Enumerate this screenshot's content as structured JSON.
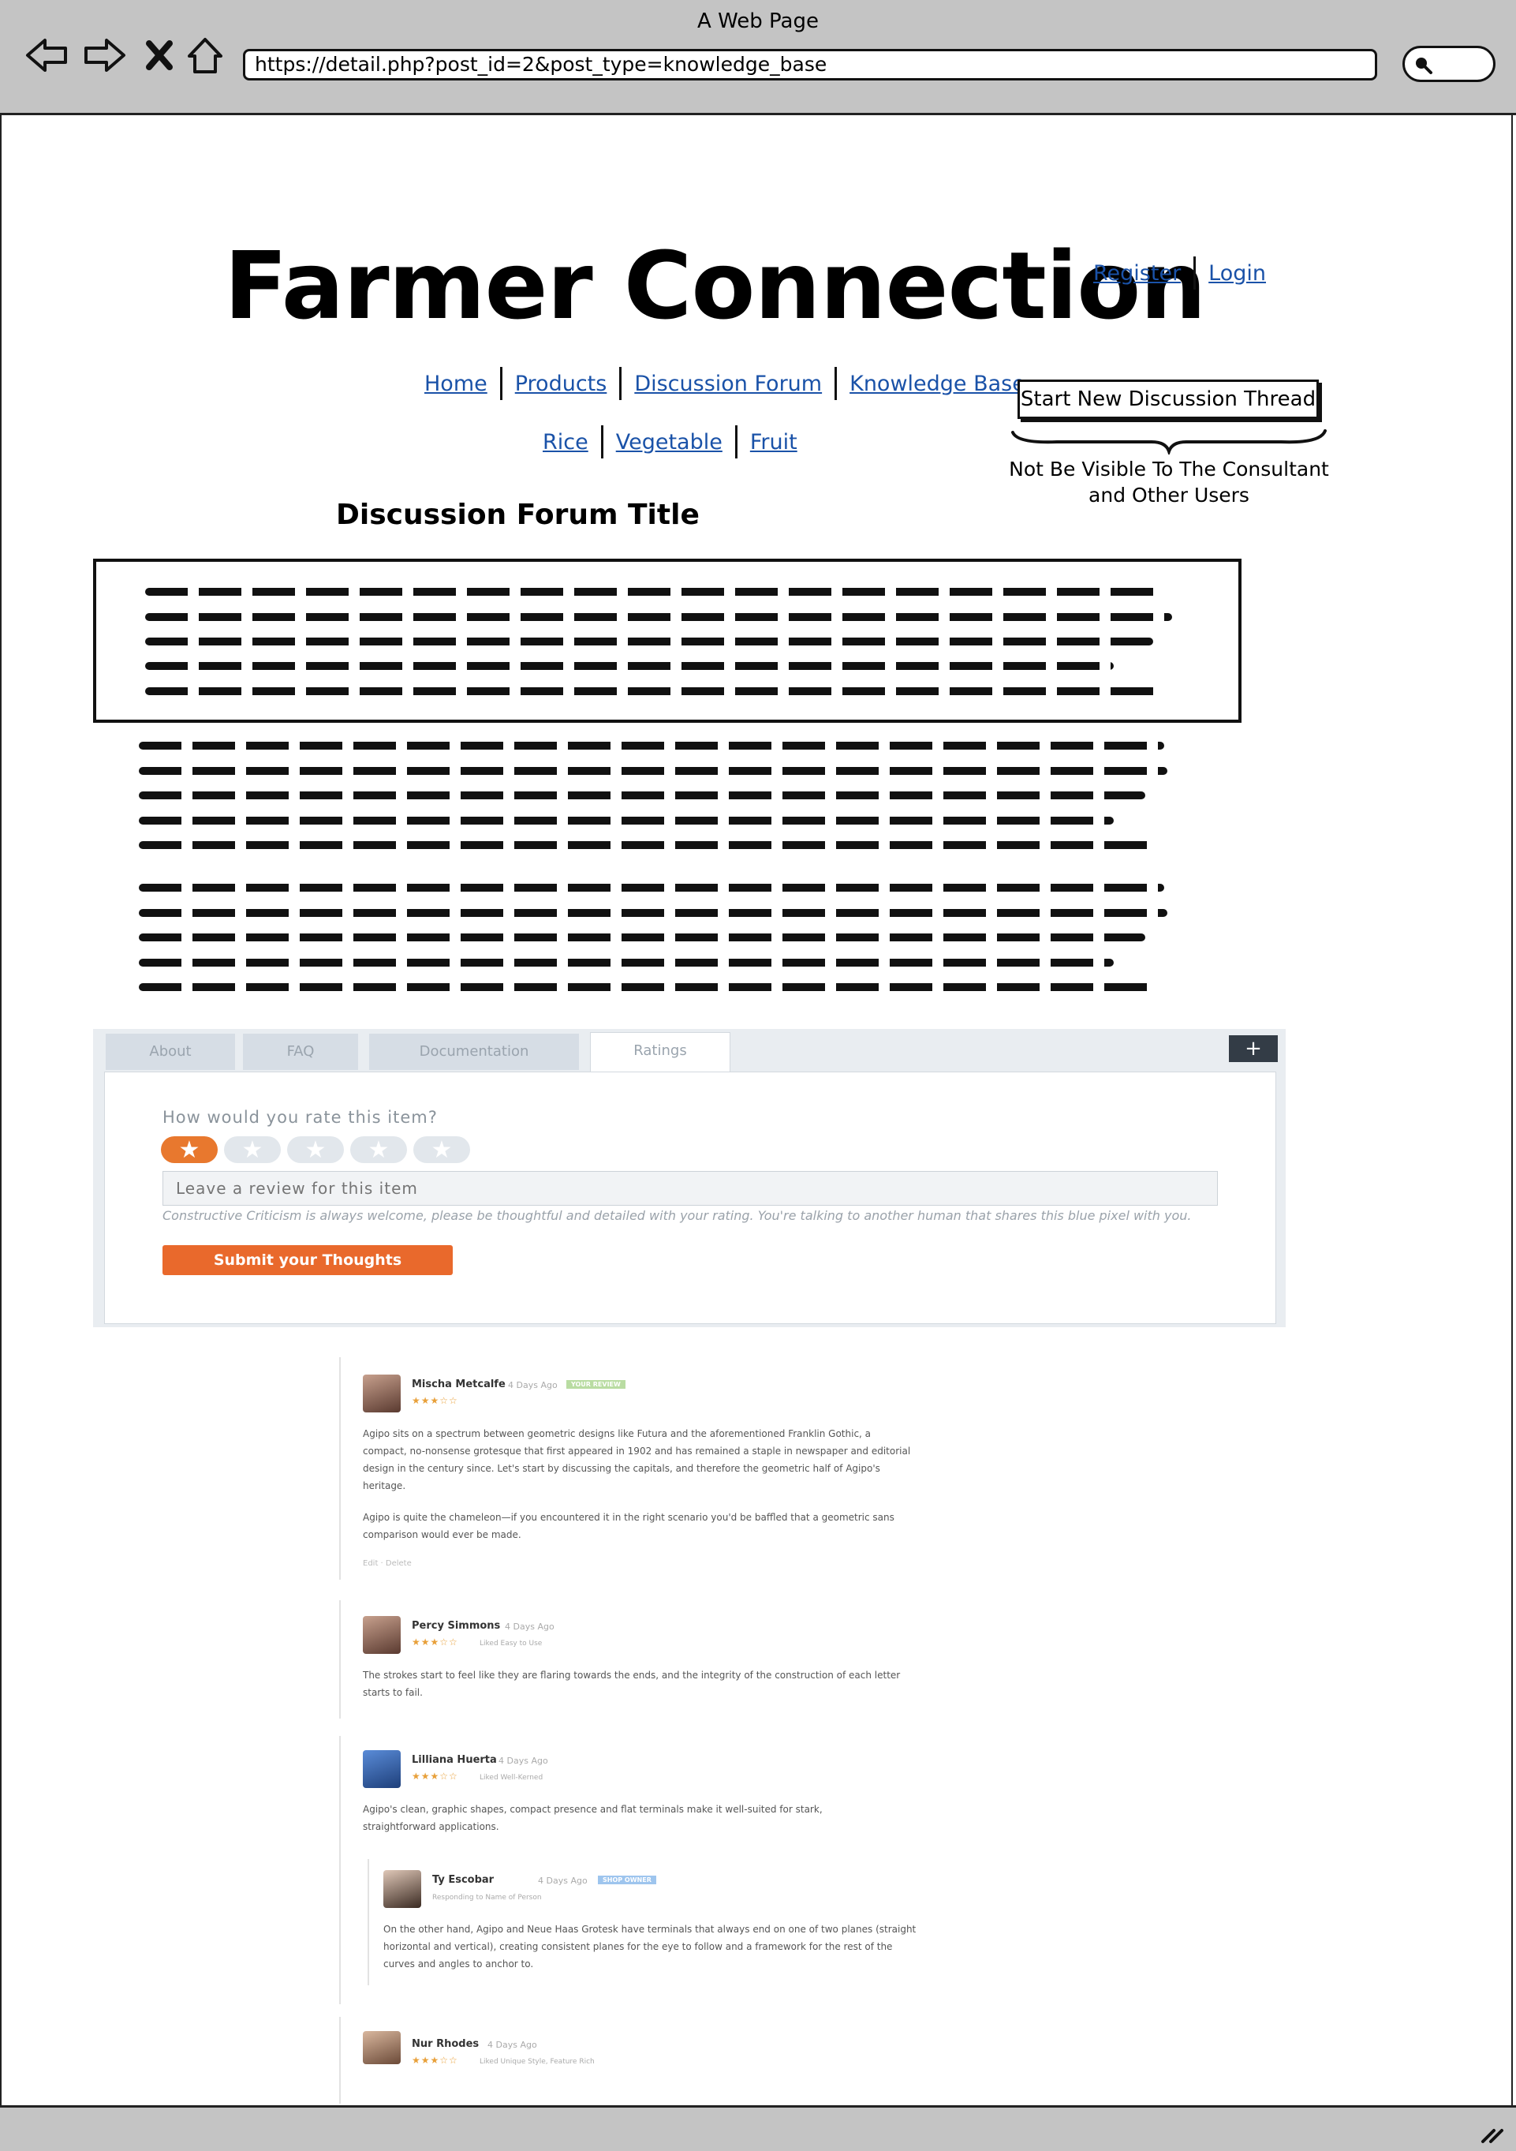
{
  "browser": {
    "window_title": "A Web Page",
    "url": "https://detail.php?post_id=2&post_type=knowledge_base"
  },
  "header": {
    "site_title": "Farmer Connection",
    "register_label": "Register",
    "login_label": "Login"
  },
  "nav": {
    "main": [
      "Home",
      "Products",
      "Discussion Forum",
      "Knowledge Base"
    ],
    "categories": [
      "Rice",
      "Vegetable",
      "Fruit"
    ]
  },
  "thread": {
    "new_button_label": "Start New Discussion Thread",
    "note": "Not Be Visible To The Consultant and Other Users"
  },
  "forum": {
    "title": "Discussion Forum  Title"
  },
  "rating": {
    "tabs": [
      "About",
      "FAQ",
      "Documentation",
      "Ratings"
    ],
    "active_tab": "Ratings",
    "bookmark_icon": "+",
    "question": "How would you rate this item?",
    "stars_selected": 1,
    "stars_total": 5,
    "review_placeholder": "Leave a review for this item",
    "hint": "Constructive Criticism is always welcome, please be thoughtful and detailed with your rating. You're talking to another human that shares this blue pixel with you.",
    "submit_label": "Submit your Thoughts",
    "accent_color": "#e9692c"
  },
  "reviews": [
    {
      "name": "Mischa Metcalfe",
      "time": "4 Days Ago",
      "badge": "YOUR REVIEW",
      "stars": "★★★☆☆",
      "paragraphs": [
        "Agipo sits on a spectrum between geometric designs like Futura and the aforementioned Franklin Gothic, a compact, no-nonsense grotesque that first appeared in 1902 and has remained a staple in newspaper and editorial design in the century since. Let's start by discussing the capitals, and therefore the geometric half of Agipo's heritage.",
        "Agipo is quite the chameleon—if you encountered it in the right scenario you'd be baffled that a geometric sans comparison would ever be made."
      ],
      "actions": "Edit · Delete"
    },
    {
      "name": "Percy Simmons",
      "time": "4 Days Ago",
      "stars": "★★★☆☆",
      "liked": "Liked Easy to Use",
      "paragraphs": [
        "The strokes start to feel like they are flaring towards the ends, and the integrity of the construction of each letter starts to fail."
      ]
    },
    {
      "name": "Lilliana Huerta",
      "time": "4 Days Ago",
      "stars": "★★★☆☆",
      "liked": "Liked Well-Kerned",
      "paragraphs": [
        "Agipo's clean, graphic shapes, compact presence and flat terminals make it well-suited for stark, straightforward applications."
      ]
    },
    {
      "name": "Ty Escobar",
      "time": "4 Days Ago",
      "badge": "SHOP OWNER",
      "sub": "Responding to Name of Person",
      "paragraphs": [
        "On the other hand, Agipo and Neue Haas Grotesk have terminals that always end on one of two planes (straight horizontal and vertical), creating consistent planes for the eye to follow and a framework for the rest of the curves and angles to anchor to."
      ]
    },
    {
      "name": "Nur Rhodes",
      "time": "4 Days Ago",
      "stars": "★★★☆☆",
      "liked": "Liked Unique Style, Feature Rich"
    }
  ]
}
